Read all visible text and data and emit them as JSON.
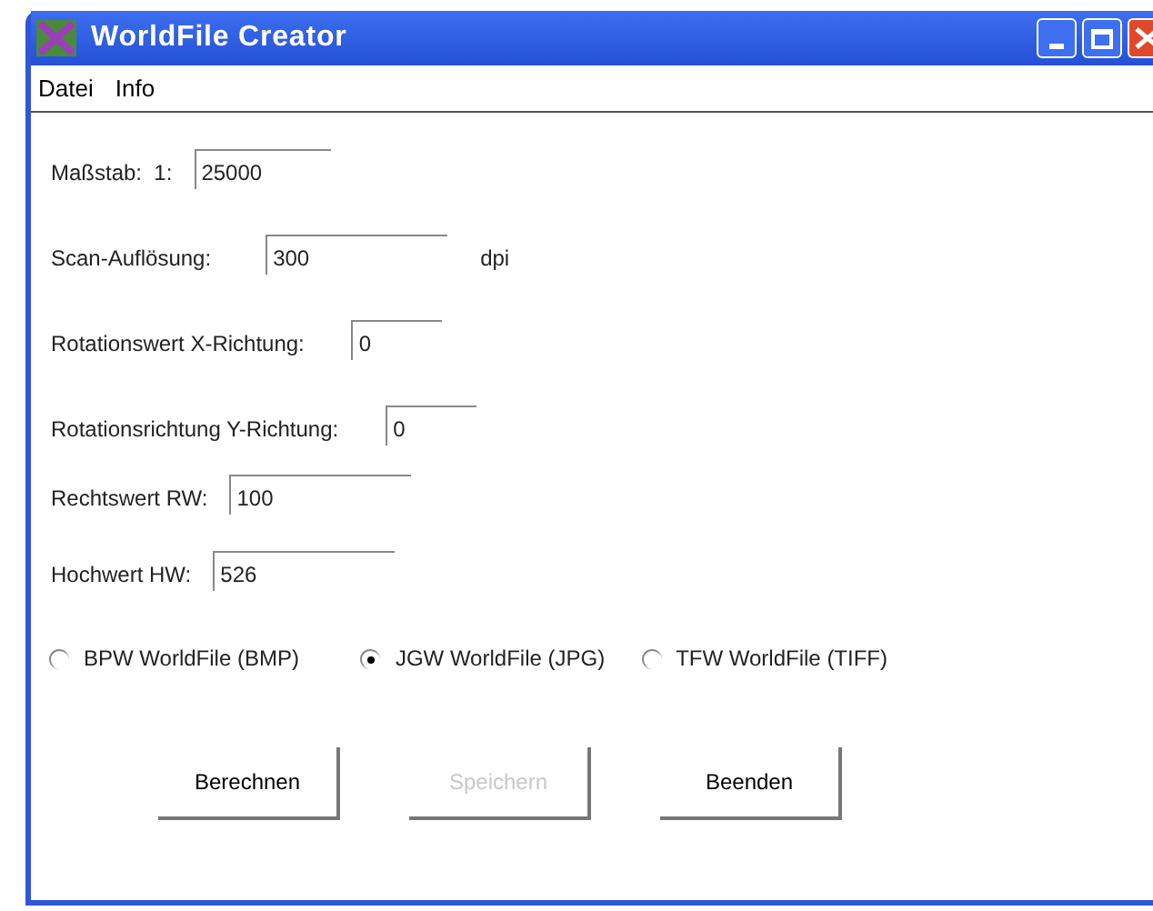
{
  "window": {
    "title": "WorldFile Creator"
  },
  "menu": [
    "Datei",
    "Info"
  ],
  "fields": [
    {
      "label": "Maßstab:  1:",
      "value": "25000",
      "kind": "medium"
    },
    {
      "label": "Scan-Auflösung:",
      "value": "300",
      "kind": "wide",
      "unit": "dpi"
    },
    {
      "label": "Rotationswert X-Richtung:",
      "value": "0",
      "kind": "narrow"
    },
    {
      "label": "Rotationsrichtung Y-Richtung:",
      "value": "0",
      "kind": "narrow"
    },
    {
      "label": "Rechtswert RW:",
      "value": "100",
      "kind": "wide"
    },
    {
      "label": "Hochwert HW:",
      "value": "526",
      "kind": "wide"
    }
  ],
  "radios": [
    {
      "label": "BPW WorldFile (BMP)",
      "selected": false
    },
    {
      "label": "JGW WorldFile (JPG)",
      "selected": true
    },
    {
      "label": "TFW WorldFile (TIFF)",
      "selected": false
    }
  ],
  "buttons": [
    {
      "label": "Berechnen",
      "disabled": false
    },
    {
      "label": "Speichern",
      "disabled": true
    },
    {
      "label": "Beenden",
      "disabled": false
    }
  ]
}
